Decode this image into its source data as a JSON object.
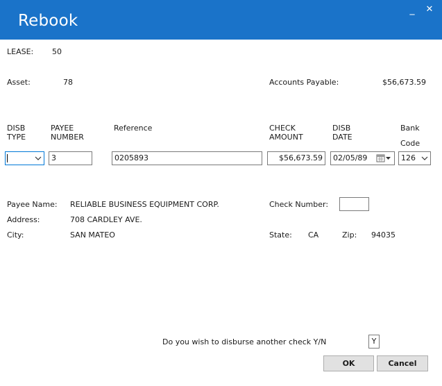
{
  "window": {
    "title": "Rebook",
    "minimize_glyph": "_",
    "close_glyph": "✕"
  },
  "lease": {
    "label": "LEASE:",
    "value": "50"
  },
  "asset": {
    "label": "Asset:",
    "value": "78"
  },
  "accounts_payable": {
    "label": "Accounts Payable:",
    "value": "$56,673.59"
  },
  "columns": {
    "disb_type": [
      "DISB",
      "TYPE"
    ],
    "payee_number": [
      "PAYEE",
      "NUMBER"
    ],
    "reference": "Reference",
    "check_amount": [
      "CHECK",
      "AMOUNT"
    ],
    "disb_date": [
      "DISB",
      "DATE"
    ],
    "bank_code": [
      "Bank",
      "Code"
    ]
  },
  "fields": {
    "disb_type": "",
    "payee_number": "3",
    "reference": "0205893",
    "check_amount": "$56,673.59",
    "disb_date": "02/05/89",
    "bank_code": "126"
  },
  "payee": {
    "name_label": "Payee Name:",
    "name": "RELIABLE BUSINESS EQUIPMENT CORP.",
    "address_label": "Address:",
    "address": "708 CARDLEY AVE.",
    "city_label": "City:",
    "city": "SAN MATEO",
    "check_number_label": "Check Number:",
    "check_number": "",
    "state_label": "State:",
    "state": "CA",
    "zip_label": "Zip:",
    "zip": "94035"
  },
  "prompt": {
    "question": "Do you wish to disburse another check Y/N",
    "answer": "Y"
  },
  "buttons": {
    "ok": "OK",
    "cancel": "Cancel"
  },
  "colors": {
    "titlebar": "#1a73c9",
    "focus_border": "#0078d7"
  },
  "icons": [
    "chevron-down-icon",
    "calendar-icon",
    "minimize-icon",
    "close-icon"
  ]
}
